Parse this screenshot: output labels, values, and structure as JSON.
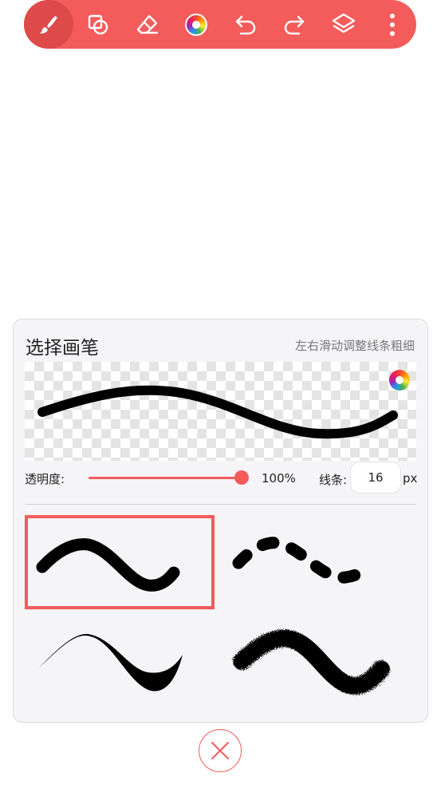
{
  "toolbar": {
    "accent": "#f45b5b",
    "tools": [
      {
        "name": "brush-icon",
        "active": true
      },
      {
        "name": "shapes-icon"
      },
      {
        "name": "eraser-icon"
      },
      {
        "name": "color-palette-icon"
      },
      {
        "name": "undo-icon"
      },
      {
        "name": "redo-icon"
      },
      {
        "name": "layers-icon"
      },
      {
        "name": "more-vertical-icon"
      }
    ]
  },
  "panel": {
    "title": "选择画笔",
    "hint": "左右滑动调整线条粗细",
    "opacity_label": "透明度:",
    "opacity_value": "100%",
    "opacity_level": 1.0,
    "line_label": "线条:",
    "line_width": "16",
    "line_unit": "px",
    "brushes": [
      {
        "name": "brush-solid",
        "selected": true
      },
      {
        "name": "brush-dashed",
        "selected": false
      },
      {
        "name": "brush-calligraphy",
        "selected": false
      },
      {
        "name": "brush-spray",
        "selected": false
      }
    ]
  },
  "close": {
    "icon": "close-icon"
  }
}
